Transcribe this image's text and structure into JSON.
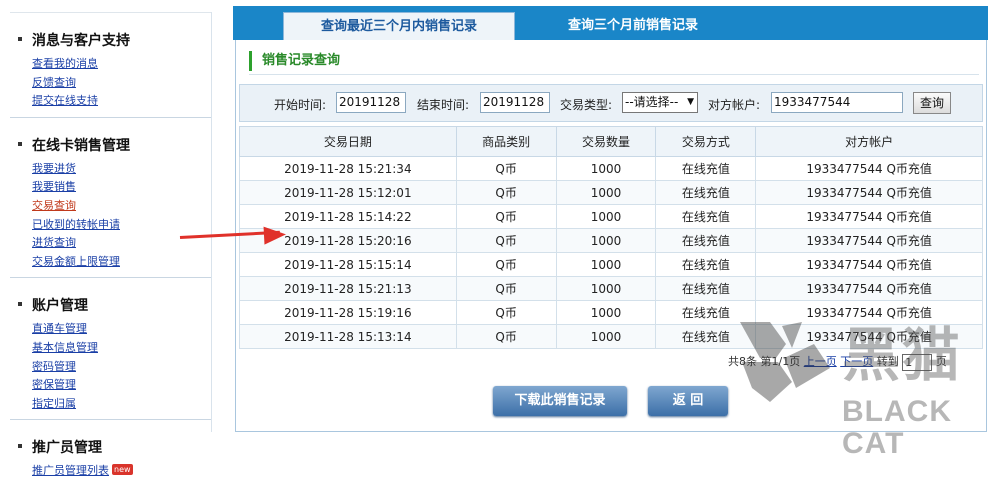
{
  "sidebar": {
    "sections": [
      {
        "title": "消息与客户支持",
        "links": [
          "查看我的消息",
          "反馈查询",
          "提交在线支持"
        ]
      },
      {
        "title": "在线卡销售管理",
        "links": [
          "我要进货",
          "我要销售",
          "交易查询",
          "已收到的转帐申请",
          "进货查询",
          "交易金额上限管理"
        ]
      },
      {
        "title": "账户管理",
        "links": [
          "直通车管理",
          "基本信息管理",
          "密码管理",
          "密保管理",
          "指定归属"
        ]
      },
      {
        "title": "推广员管理",
        "links": [
          "推广员管理列表"
        ],
        "badge": "new"
      }
    ],
    "active_link": "交易查询"
  },
  "tabs": [
    "查询最近三个月内销售记录",
    "查询三个月前销售记录"
  ],
  "panel_title": "销售记录查询",
  "search": {
    "start_label": "开始时间:",
    "start_value": "20191128",
    "end_label": "结束时间:",
    "end_value": "20191128",
    "type_label": "交易类型:",
    "type_value": "--请选择--",
    "account_label": "对方帐户:",
    "account_value": "1933477544",
    "query_button": "查询"
  },
  "table": {
    "headers": [
      "交易日期",
      "商品类别",
      "交易数量",
      "交易方式",
      "对方帐户"
    ],
    "rows": [
      [
        "2019-11-28 15:21:34",
        "Q币",
        "1000",
        "在线充值",
        "1933477544 Q币充值"
      ],
      [
        "2019-11-28 15:12:01",
        "Q币",
        "1000",
        "在线充值",
        "1933477544 Q币充值"
      ],
      [
        "2019-11-28 15:14:22",
        "Q币",
        "1000",
        "在线充值",
        "1933477544 Q币充值"
      ],
      [
        "2019-11-28 15:20:16",
        "Q币",
        "1000",
        "在线充值",
        "1933477544 Q币充值"
      ],
      [
        "2019-11-28 15:15:14",
        "Q币",
        "1000",
        "在线充值",
        "1933477544 Q币充值"
      ],
      [
        "2019-11-28 15:21:13",
        "Q币",
        "1000",
        "在线充值",
        "1933477544 Q币充值"
      ],
      [
        "2019-11-28 15:19:16",
        "Q币",
        "1000",
        "在线充值",
        "1933477544 Q币充值"
      ],
      [
        "2019-11-28 15:13:14",
        "Q币",
        "1000",
        "在线充值",
        "1933477544 Q币充值"
      ]
    ]
  },
  "pager": {
    "total": "共8条",
    "page_info": "第1/1页",
    "prev": "上一页",
    "next": "下一页",
    "goto_label": "转到",
    "goto_value": "1",
    "page_suffix": "页"
  },
  "buttons": {
    "download": "下载此销售记录",
    "back": "返 回"
  },
  "watermark": {
    "cn": "黑猫",
    "en": "BLACK CAT"
  },
  "colors": {
    "tab_bar": "#1a86c8",
    "link": "#1a3fa6",
    "active_link": "#c0391b",
    "title_green": "#2a8a2a",
    "arrow": "#e0312a"
  }
}
